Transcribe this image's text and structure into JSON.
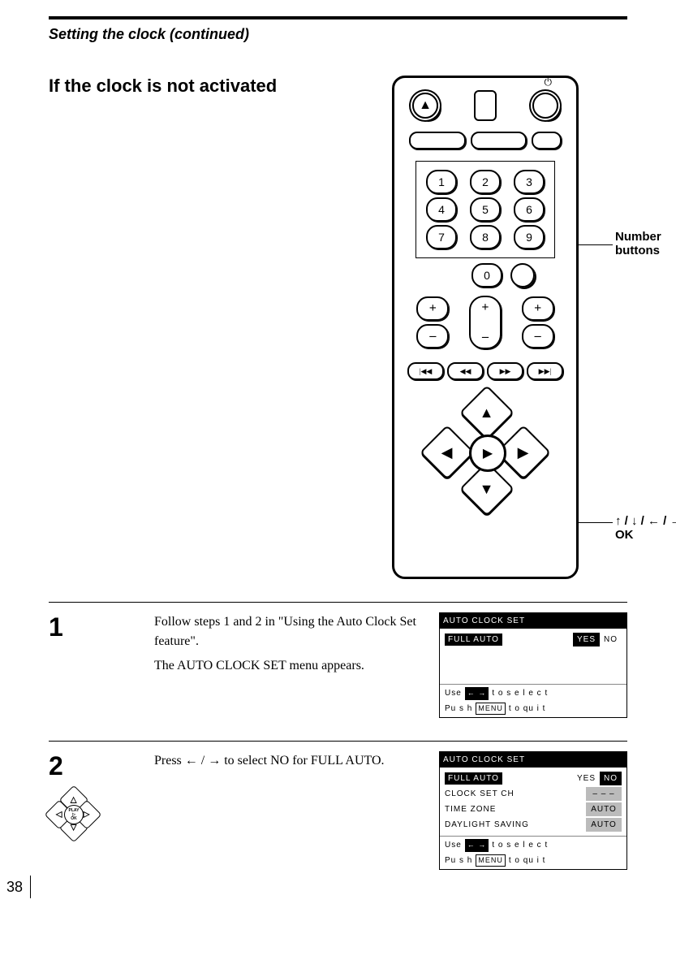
{
  "page_number": "38",
  "header": {
    "section_title": "Setting the clock (continued)"
  },
  "heading": "If the clock is not activated",
  "callouts": {
    "number_buttons": "Number\nbuttons",
    "dpad_ok": "↑ / ↓ / ← / →\nOK"
  },
  "remote": {
    "numbers": [
      "1",
      "2",
      "3",
      "4",
      "5",
      "6",
      "7",
      "8",
      "9",
      "0"
    ],
    "rocker_plus": "+",
    "rocker_minus": "–",
    "transport": [
      "◀◀",
      "◀◀",
      "▶▶",
      "▶▶"
    ],
    "dpad": {
      "up": "▲",
      "down": "▼",
      "left": "◀",
      "right": "▶",
      "center": "▶"
    }
  },
  "steps": [
    {
      "num": "1",
      "text_line1": "Follow steps 1 and 2 in \"Using the Auto Clock Set feature\".",
      "text_line2": "The AUTO CLOCK SET menu appears.",
      "screen": {
        "title": "AUTO  CLOCK  SET",
        "rows": [
          {
            "label": "FULL  AUTO",
            "label_hl": true,
            "yes": "YES",
            "yes_active": true,
            "no": "NO"
          }
        ],
        "hint_use": "Use",
        "hint_use_box": "← →",
        "hint_use_tail": "t o  s e l e c t",
        "hint_push": "Pu s h",
        "hint_push_box": "MENU",
        "hint_push_tail": "t o  qu i t"
      }
    },
    {
      "num": "2",
      "text_line1": "Press ← / → to select NO for FULL AUTO.",
      "screen": {
        "title": "AUTO  CLOCK  SET",
        "rows": [
          {
            "label": "FULL  AUTO",
            "label_hl": true,
            "yes": "YES",
            "no": "NO",
            "no_active": true
          },
          {
            "label": "CLOCK  SET  CH",
            "val": "– – –",
            "val_hl": true
          },
          {
            "label": "TIME  ZONE",
            "val": "AUTO",
            "val_hl": true
          },
          {
            "label": "DAYLIGHT  SAVING",
            "val": "AUTO",
            "val_hl": true
          }
        ],
        "hint_use": "Use",
        "hint_use_box": "← →",
        "hint_use_tail": "t o  s e l e c t",
        "hint_push": "Pu s h",
        "hint_push_box": "MENU",
        "hint_push_tail": "t o  qu i t"
      },
      "mini_dpad": {
        "center_top": "PLAY",
        "center_arrow": "▷",
        "center_bot": "OK"
      }
    }
  ]
}
